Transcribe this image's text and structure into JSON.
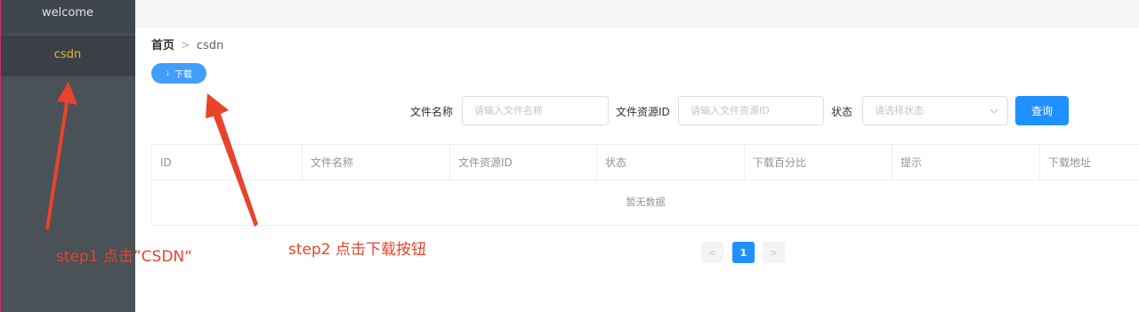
{
  "sidebar": {
    "items": [
      {
        "label": "welcome"
      },
      {
        "label": "csdn"
      }
    ]
  },
  "breadcrumb": {
    "home": "首页",
    "separator": ">",
    "current": "csdn"
  },
  "toolbar": {
    "download_icon": "↓",
    "download_label": "下载"
  },
  "search": {
    "file_name_label": "文件名称",
    "file_name_placeholder": "请输入文件名称",
    "resource_id_label": "文件资源ID",
    "resource_id_placeholder": "请输入文件资源ID",
    "status_label": "状态",
    "status_placeholder": "请选择状态",
    "query_label": "查询"
  },
  "table": {
    "columns": [
      "ID",
      "文件名称",
      "文件资源ID",
      "状态",
      "下载百分比",
      "提示",
      "下载地址"
    ],
    "empty_text": "暂无数据"
  },
  "pagination": {
    "prev": "<",
    "current_page": "1",
    "next": ">"
  },
  "annotations": {
    "step1": "step1 点击”CSDN“",
    "step2": "step2 点击下载按钮"
  },
  "colors": {
    "sidebar_bg": "#4a5157",
    "active_menu_text": "#e8b52f",
    "primary": "#409eff",
    "annotation_red": "#e8432c"
  }
}
